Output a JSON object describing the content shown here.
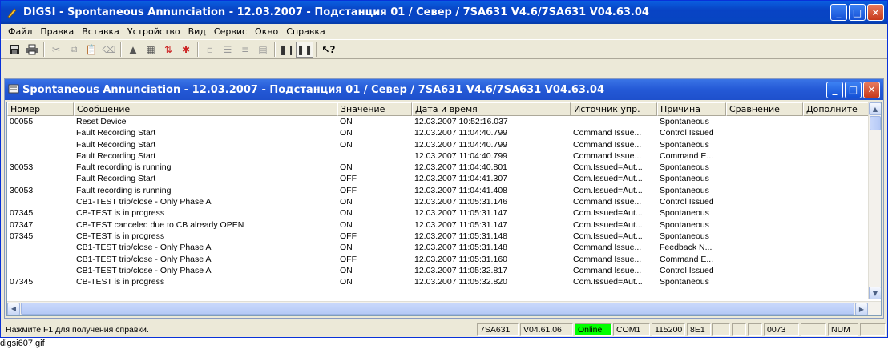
{
  "window": {
    "title": "DIGSI - Spontaneous Annunciation - 12.03.2007 - Подстанция 01 / Север / 7SA631 V4.6/7SA631 V04.63.04",
    "app_icon": "digsi-pen-icon"
  },
  "menu": [
    "Файл",
    "Правка",
    "Вставка",
    "Устройство",
    "Вид",
    "Сервис",
    "Окно",
    "Справка"
  ],
  "toolbar": {
    "buttons": [
      "save-icon",
      "print-icon",
      "cut-icon",
      "copy-icon",
      "paste-icon",
      "delete-icon",
      "insert-icon",
      "properties-icon",
      "sort-icon",
      "filter-icon",
      "small-icons-icon",
      "list-icon",
      "details-icon",
      "table-icon",
      "online-icon",
      "offline-icon",
      "help-pointer-icon"
    ]
  },
  "child_window": {
    "title": "Spontaneous Annunciation - 12.03.2007 - Подстанция 01 / Север / 7SA631 V4.6/7SA631 V04.63.04"
  },
  "table": {
    "columns": [
      "Номер",
      "Сообщение",
      "Значение",
      "Дата и время",
      "Источник упр.",
      "Причина",
      "Сравнение",
      "Дополните"
    ],
    "rows": [
      [
        "00055",
        "Reset Device",
        "ON",
        "12.03.2007  10:52:16.037",
        "",
        "Spontaneous",
        "",
        ""
      ],
      [
        "",
        "Fault Recording Start",
        "ON",
        "12.03.2007  11:04:40.799",
        "Command Issue...",
        "Control Issued",
        "",
        ""
      ],
      [
        "",
        "Fault Recording Start",
        "ON",
        "12.03.2007  11:04:40.799",
        "Command Issue...",
        "Spontaneous",
        "",
        ""
      ],
      [
        "",
        "Fault Recording Start",
        "",
        "12.03.2007  11:04:40.799",
        "Command Issue...",
        "Command E...",
        "",
        ""
      ],
      [
        "30053",
        "Fault recording is running",
        "ON",
        "12.03.2007  11:04:40.801",
        "Com.Issued=Aut...",
        "Spontaneous",
        "",
        ""
      ],
      [
        "",
        "Fault Recording Start",
        "OFF",
        "12.03.2007  11:04:41.307",
        "Com.Issued=Aut...",
        "Spontaneous",
        "",
        ""
      ],
      [
        "30053",
        "Fault recording is running",
        "OFF",
        "12.03.2007  11:04:41.408",
        "Com.Issued=Aut...",
        "Spontaneous",
        "",
        ""
      ],
      [
        "",
        "CB1-TEST trip/close - Only Phase A",
        "ON",
        "12.03.2007  11:05:31.146",
        "Command Issue...",
        "Control Issued",
        "",
        ""
      ],
      [
        "07345",
        "CB-TEST is in progress",
        "ON",
        "12.03.2007  11:05:31.147",
        "Com.Issued=Aut...",
        "Spontaneous",
        "",
        ""
      ],
      [
        "07347",
        "CB-TEST canceled due to CB already OPEN",
        "ON",
        "12.03.2007  11:05:31.147",
        "Com.Issued=Aut...",
        "Spontaneous",
        "",
        ""
      ],
      [
        "07345",
        "CB-TEST is in progress",
        "OFF",
        "12.03.2007  11:05:31.148",
        "Com.Issued=Aut...",
        "Spontaneous",
        "",
        ""
      ],
      [
        "",
        "CB1-TEST trip/close - Only Phase A",
        "ON",
        "12.03.2007  11:05:31.148",
        "Command Issue...",
        "Feedback N...",
        "",
        ""
      ],
      [
        "",
        "CB1-TEST trip/close - Only Phase A",
        "OFF",
        "12.03.2007  11:05:31.160",
        "Command Issue...",
        "Command E...",
        "",
        ""
      ],
      [
        "",
        "CB1-TEST trip/close - Only Phase A",
        "ON",
        "12.03.2007  11:05:32.817",
        "Command Issue...",
        "Control Issued",
        "",
        ""
      ],
      [
        "07345",
        "CB-TEST is in progress",
        "ON",
        "12.03.2007  11:05:32.820",
        "Com.Issued=Aut...",
        "Spontaneous",
        "",
        ""
      ]
    ]
  },
  "statusbar": {
    "help_text": "Нажмите F1 для получения справки.",
    "device": "7SA631",
    "version": "V04.61.06",
    "mode": "Online",
    "port": "COM1",
    "baud": "115200",
    "format": "8E1",
    "blank1": "",
    "blank2": "",
    "blank3": "",
    "address": "0073",
    "blank4": "",
    "numlock": "NUM",
    "blank5": ""
  },
  "caption": "digsi607.gif",
  "colors": {
    "title_blue": "#0843c4",
    "online_green": "#00ff00",
    "close_red": "#c8391a"
  }
}
